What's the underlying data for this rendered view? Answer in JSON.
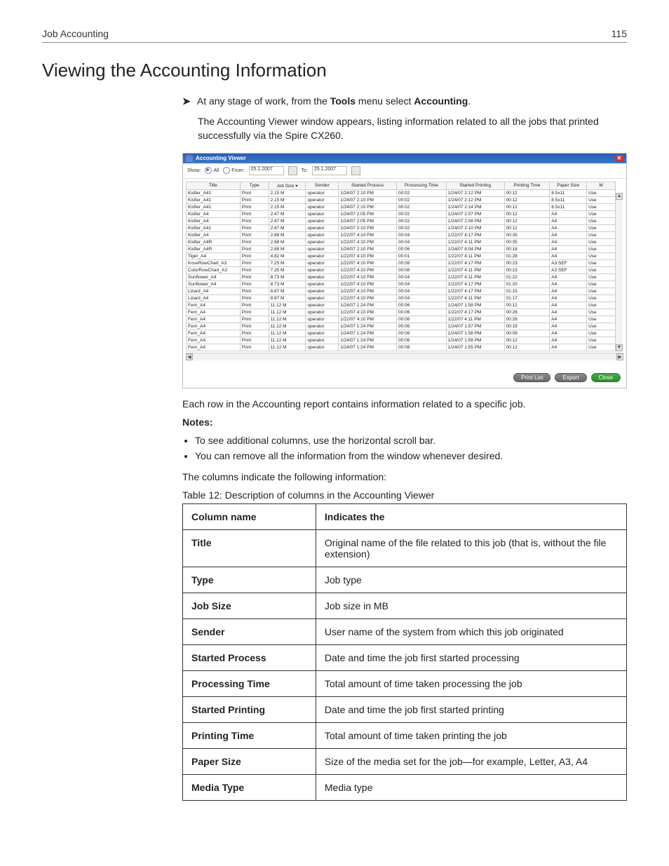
{
  "page": {
    "section": "Job Accounting",
    "number": "115",
    "heading": "Viewing the Accounting Information"
  },
  "body": {
    "step_pre": "At any stage of work, from the ",
    "step_bold1": "Tools",
    "step_mid": " menu select ",
    "step_bold2": "Accounting",
    "step_post": ".",
    "step_result": "The Accounting Viewer window appears, listing information related to all the jobs that printed successfully via the Spire CX260.",
    "after_img": "Each row in the Accounting report contains information related to a specific job.",
    "notes_label": "Notes:",
    "notes": [
      "To see additional columns, use the horizontal scroll bar.",
      "You can remove all the information from the window whenever desired."
    ],
    "cols_intro": "The columns indicate the following information:",
    "table_caption": "Table 12: Description of columns in the Accounting Viewer"
  },
  "viewer": {
    "title": "Accounting Viewer",
    "show_label": "Show:",
    "radio_all": "All",
    "radio_from": "From:",
    "to_label": "To:",
    "date1": "25.1.2007",
    "date2": "25.1.2007",
    "headers": {
      "title": "Title",
      "type": "Type",
      "jobsize": "Job Size",
      "sender": "Sender",
      "started_process": "Started Process",
      "processing_time": "Processing Time",
      "started_printing": "Started Printing",
      "printing_time": "Printing Time",
      "paper_size": "Paper Size",
      "m": "M"
    },
    "rows": [
      {
        "title": "Kisfier_A41",
        "type": "Print",
        "size": "2.15 M",
        "sender": "operator",
        "sp": "1/24/07 2:10 PM",
        "pt": "00:02",
        "spr": "1/24/07 2:12 PM",
        "prt": "00:12",
        "paper": "8.5x11",
        "m": "Use"
      },
      {
        "title": "Kisfier_A41",
        "type": "Print",
        "size": "2.15 M",
        "sender": "operator",
        "sp": "1/24/07 2:10 PM",
        "pt": "00:02",
        "spr": "1/24/07 2:12 PM",
        "prt": "00:12",
        "paper": "8.5x11",
        "m": "Use"
      },
      {
        "title": "Kisfier_A41",
        "type": "Print",
        "size": "2.15 M",
        "sender": "operator",
        "sp": "1/24/07 2:10 PM",
        "pt": "00:02",
        "spr": "1/24/07 2:14 PM",
        "prt": "00:12",
        "paper": "8.5x11",
        "m": "Use"
      },
      {
        "title": "Kisfier_A4",
        "type": "Print",
        "size": "2.47 M",
        "sender": "operator",
        "sp": "1/24/07 2:05 PM",
        "pt": "00:02",
        "spr": "1/24/07 2:07 PM",
        "prt": "00:12",
        "paper": "A4",
        "m": "Use"
      },
      {
        "title": "Kisfier_A4",
        "type": "Print",
        "size": "2.47 M",
        "sender": "operator",
        "sp": "1/24/07 2:05 PM",
        "pt": "00:02",
        "spr": "1/24/07 2:08 PM",
        "prt": "00:12",
        "paper": "A4",
        "m": "Use"
      },
      {
        "title": "Kisfier_A41",
        "type": "Print",
        "size": "2.47 M",
        "sender": "operator",
        "sp": "1/24/07 2:10 PM",
        "pt": "00:02",
        "spr": "1/24/07 2:10 PM",
        "prt": "00:12",
        "paper": "A4",
        "m": "Use"
      },
      {
        "title": "Kisfier_A4",
        "type": "Print",
        "size": "2.88 M",
        "sender": "operator",
        "sp": "1/22/07 4:10 PM",
        "pt": "00:04",
        "spr": "1/22/07 4:17 PM",
        "prt": "00:35",
        "paper": "A4",
        "m": "Use"
      },
      {
        "title": "Kisfier_A4R",
        "type": "Print",
        "size": "2.88 M",
        "sender": "operator",
        "sp": "1/22/07 4:10 PM",
        "pt": "00:04",
        "spr": "1/22/07 4:11 PM",
        "prt": "00:35",
        "paper": "A4",
        "m": "Use"
      },
      {
        "title": "Kisfier_A4R",
        "type": "Print",
        "size": "2.88 M",
        "sender": "operator",
        "sp": "1/24/07 2:10 PM",
        "pt": "00:06",
        "spr": "1/24/07 8:04 PM",
        "prt": "00:18",
        "paper": "A4",
        "m": "Use"
      },
      {
        "title": "Tiger_A4",
        "type": "Print",
        "size": "4.82 M",
        "sender": "operator",
        "sp": "1/22/07 4:10 PM",
        "pt": "00:01",
        "spr": "1/22/07 4:11 PM",
        "prt": "01:28",
        "paper": "A4",
        "m": "Use"
      },
      {
        "title": "KoseRowChart_A3",
        "type": "Print",
        "size": "7.25 M",
        "sender": "operator",
        "sp": "1/22/07 4:10 PM",
        "pt": "00:08",
        "spr": "1/22/07 4:17 PM",
        "prt": "00:23",
        "paper": "A3 SEF",
        "m": "Use"
      },
      {
        "title": "ColorRowChart_A3",
        "type": "Print",
        "size": "7.25 M",
        "sender": "operator",
        "sp": "1/22/07 4:10 PM",
        "pt": "00:08",
        "spr": "1/22/07 4:11 PM",
        "prt": "00:23",
        "paper": "A3 SEF",
        "m": "Use"
      },
      {
        "title": "Sunflower_A4",
        "type": "Print",
        "size": "8.73 M",
        "sender": "operator",
        "sp": "1/22/07 4:10 PM",
        "pt": "00:04",
        "spr": "1/22/07 4:11 PM",
        "prt": "01:22",
        "paper": "A4",
        "m": "Use"
      },
      {
        "title": "Sunflower_A4",
        "type": "Print",
        "size": "8.73 M",
        "sender": "operator",
        "sp": "1/22/07 4:10 PM",
        "pt": "00:04",
        "spr": "1/22/07 4:17 PM",
        "prt": "01:20",
        "paper": "A4",
        "m": "Use"
      },
      {
        "title": "Lizard_A4",
        "type": "Print",
        "size": "8.87 M",
        "sender": "operator",
        "sp": "1/22/07 4:10 PM",
        "pt": "00:04",
        "spr": "1/22/07 4:17 PM",
        "prt": "01:15",
        "paper": "A4",
        "m": "Use"
      },
      {
        "title": "Lizard_A4",
        "type": "Print",
        "size": "8.87 M",
        "sender": "operator",
        "sp": "1/22/07 4:10 PM",
        "pt": "00:04",
        "spr": "1/22/07 4:11 PM",
        "prt": "01:17",
        "paper": "A4",
        "m": "Use"
      },
      {
        "title": "Fern_A4",
        "type": "Print",
        "size": "11.12 M",
        "sender": "operator",
        "sp": "1/24/07 1:24 PM",
        "pt": "00:06",
        "spr": "1/24/07 1:58 PM",
        "prt": "00:12",
        "paper": "A4",
        "m": "Use"
      },
      {
        "title": "Fern_A4",
        "type": "Print",
        "size": "11.12 M",
        "sender": "operator",
        "sp": "1/22/07 4:10 PM",
        "pt": "00:06",
        "spr": "1/22/07 4:17 PM",
        "prt": "00:28",
        "paper": "A4",
        "m": "Use"
      },
      {
        "title": "Fern_A4",
        "type": "Print",
        "size": "11.12 M",
        "sender": "operator",
        "sp": "1/22/07 4:10 PM",
        "pt": "00:06",
        "spr": "1/22/07 4:11 PM",
        "prt": "00:28",
        "paper": "A4",
        "m": "Use"
      },
      {
        "title": "Fern_A4",
        "type": "Print",
        "size": "11.12 M",
        "sender": "operator",
        "sp": "1/24/07 1:24 PM",
        "pt": "00:06",
        "spr": "1/24/07 1:57 PM",
        "prt": "00:19",
        "paper": "A4",
        "m": "Use"
      },
      {
        "title": "Fern_A4",
        "type": "Print",
        "size": "11.12 M",
        "sender": "operator",
        "sp": "1/24/07 1:24 PM",
        "pt": "00:06",
        "spr": "1/24/07 1:58 PM",
        "prt": "00:09",
        "paper": "A4",
        "m": "Use"
      },
      {
        "title": "Fern_A4",
        "type": "Print",
        "size": "11.12 M",
        "sender": "operator",
        "sp": "1/24/07 1:24 PM",
        "pt": "00:06",
        "spr": "1/24/07 1:58 PM",
        "prt": "00:12",
        "paper": "A4",
        "m": "Use"
      },
      {
        "title": "Fern_A4",
        "type": "Print",
        "size": "11.12 M",
        "sender": "operator",
        "sp": "1/24/07 1:24 PM",
        "pt": "00:08",
        "spr": "1/24/07 1:55 PM",
        "prt": "00:12",
        "paper": "A4",
        "m": "Use"
      }
    ],
    "buttons": {
      "print": "Print List",
      "export": "Export",
      "close": "Close"
    }
  },
  "desc_table": {
    "h1": "Column name",
    "h2": "Indicates the",
    "rows": [
      {
        "c": "Title",
        "d": "Original name of the file related to this job (that is, without the file extension)"
      },
      {
        "c": "Type",
        "d": "Job type"
      },
      {
        "c": "Job Size",
        "d": "Job size in MB"
      },
      {
        "c": "Sender",
        "d": "User name of the system from which this job originated"
      },
      {
        "c": "Started Process",
        "d": "Date and time the job first started processing"
      },
      {
        "c": "Processing Time",
        "d": "Total amount of time taken processing the job"
      },
      {
        "c": "Started Printing",
        "d": "Date and time the job first started printing"
      },
      {
        "c": "Printing Time",
        "d": "Total amount of time taken printing the job"
      },
      {
        "c": "Paper Size",
        "d": "Size of the media set for the job—for example, Letter, A3, A4"
      },
      {
        "c": "Media Type",
        "d": "Media type"
      }
    ]
  }
}
